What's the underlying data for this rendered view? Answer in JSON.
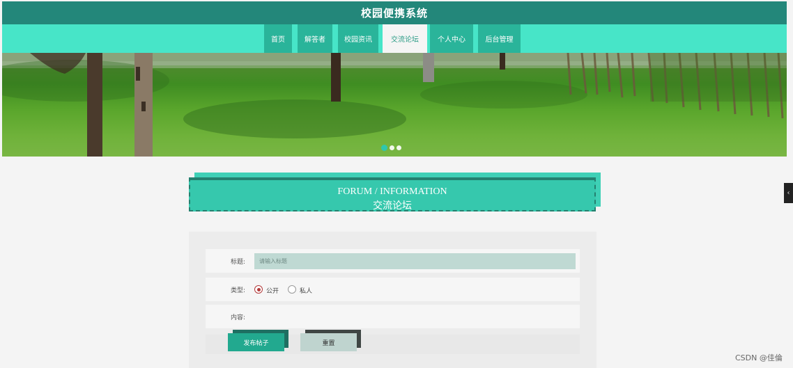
{
  "header": {
    "title": "校园便携系统"
  },
  "nav": {
    "items": [
      {
        "label": "首页",
        "active": false
      },
      {
        "label": "解答者",
        "active": false
      },
      {
        "label": "校园资讯",
        "active": false
      },
      {
        "label": "交流论坛",
        "active": true
      },
      {
        "label": "个人中心",
        "active": false
      },
      {
        "label": "后台管理",
        "active": false
      }
    ]
  },
  "banner": {
    "slide_count": 3,
    "active_slide": 1
  },
  "section": {
    "title_en": "FORUM / INFORMATION",
    "title_cn": "交流论坛"
  },
  "form": {
    "title_label": "标题:",
    "title_placeholder": "请输入标题",
    "type_label": "类型:",
    "type_options": [
      {
        "label": "公开",
        "checked": true
      },
      {
        "label": "私人",
        "checked": false
      }
    ],
    "content_label": "内容:",
    "submit_label": "发布帖子",
    "reset_label": "重置"
  },
  "side_tab": {
    "icon": "chevron-left-icon",
    "glyph": "‹"
  },
  "watermark": "CSDN @佳倫",
  "colors": {
    "header": "#23877a",
    "nav": "#47e5c8",
    "accent": "#22a98f"
  }
}
